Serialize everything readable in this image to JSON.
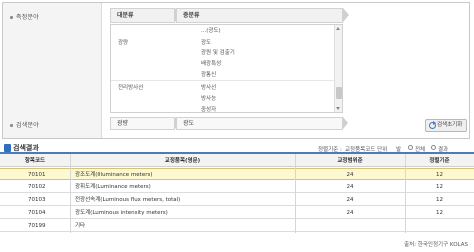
{
  "filters": {
    "measure_field_label": "측정분야",
    "search_field_label": "검색분야",
    "major_header": "대분류",
    "middle_header": "중분류",
    "categories": [
      {
        "name": "광량",
        "items": [
          "...(광도)",
          "광도",
          "광원 및 검출기",
          "배광특성",
          "광통신"
        ]
      },
      {
        "name": "전리방사선",
        "items": [
          "방사선",
          "방사능",
          "중성자"
        ]
      }
    ],
    "selected_major": "광량",
    "selected_middle": "광도",
    "reset_label": "검색초기화"
  },
  "results": {
    "title": "검색결과",
    "sort_options": [
      "정렬기준 :",
      "교정품목코드 단위",
      "발"
    ],
    "filter_options": [
      "전체",
      "결과"
    ],
    "columns": [
      "항목코드",
      "교정품목(영문)",
      "교정범위준",
      "정렬기준"
    ],
    "rows": [
      {
        "code": "70101",
        "name": "광조도계(Illuminance meters)",
        "range": "24",
        "sort": "12",
        "highlighted": true
      },
      {
        "code": "70102",
        "name": "광휘도계(Luminance meters)",
        "range": "24",
        "sort": "12",
        "highlighted": false
      },
      {
        "code": "70103",
        "name": "전광선속계(Luminous flux meters, total)",
        "range": "24",
        "sort": "12",
        "highlighted": false
      },
      {
        "code": "70104",
        "name": "광도계(Luminous intensity meters)",
        "range": "24",
        "sort": "12",
        "highlighted": false
      },
      {
        "code": "70199",
        "name": "기타",
        "range": "",
        "sort": "",
        "highlighted": false
      }
    ],
    "source": "출처: 한국인정기구 KOLAS"
  },
  "colors": {
    "accent": "#4c7bbd",
    "highlight_row": "#fcf8cf",
    "icon_blue": "#2f6fbf"
  }
}
